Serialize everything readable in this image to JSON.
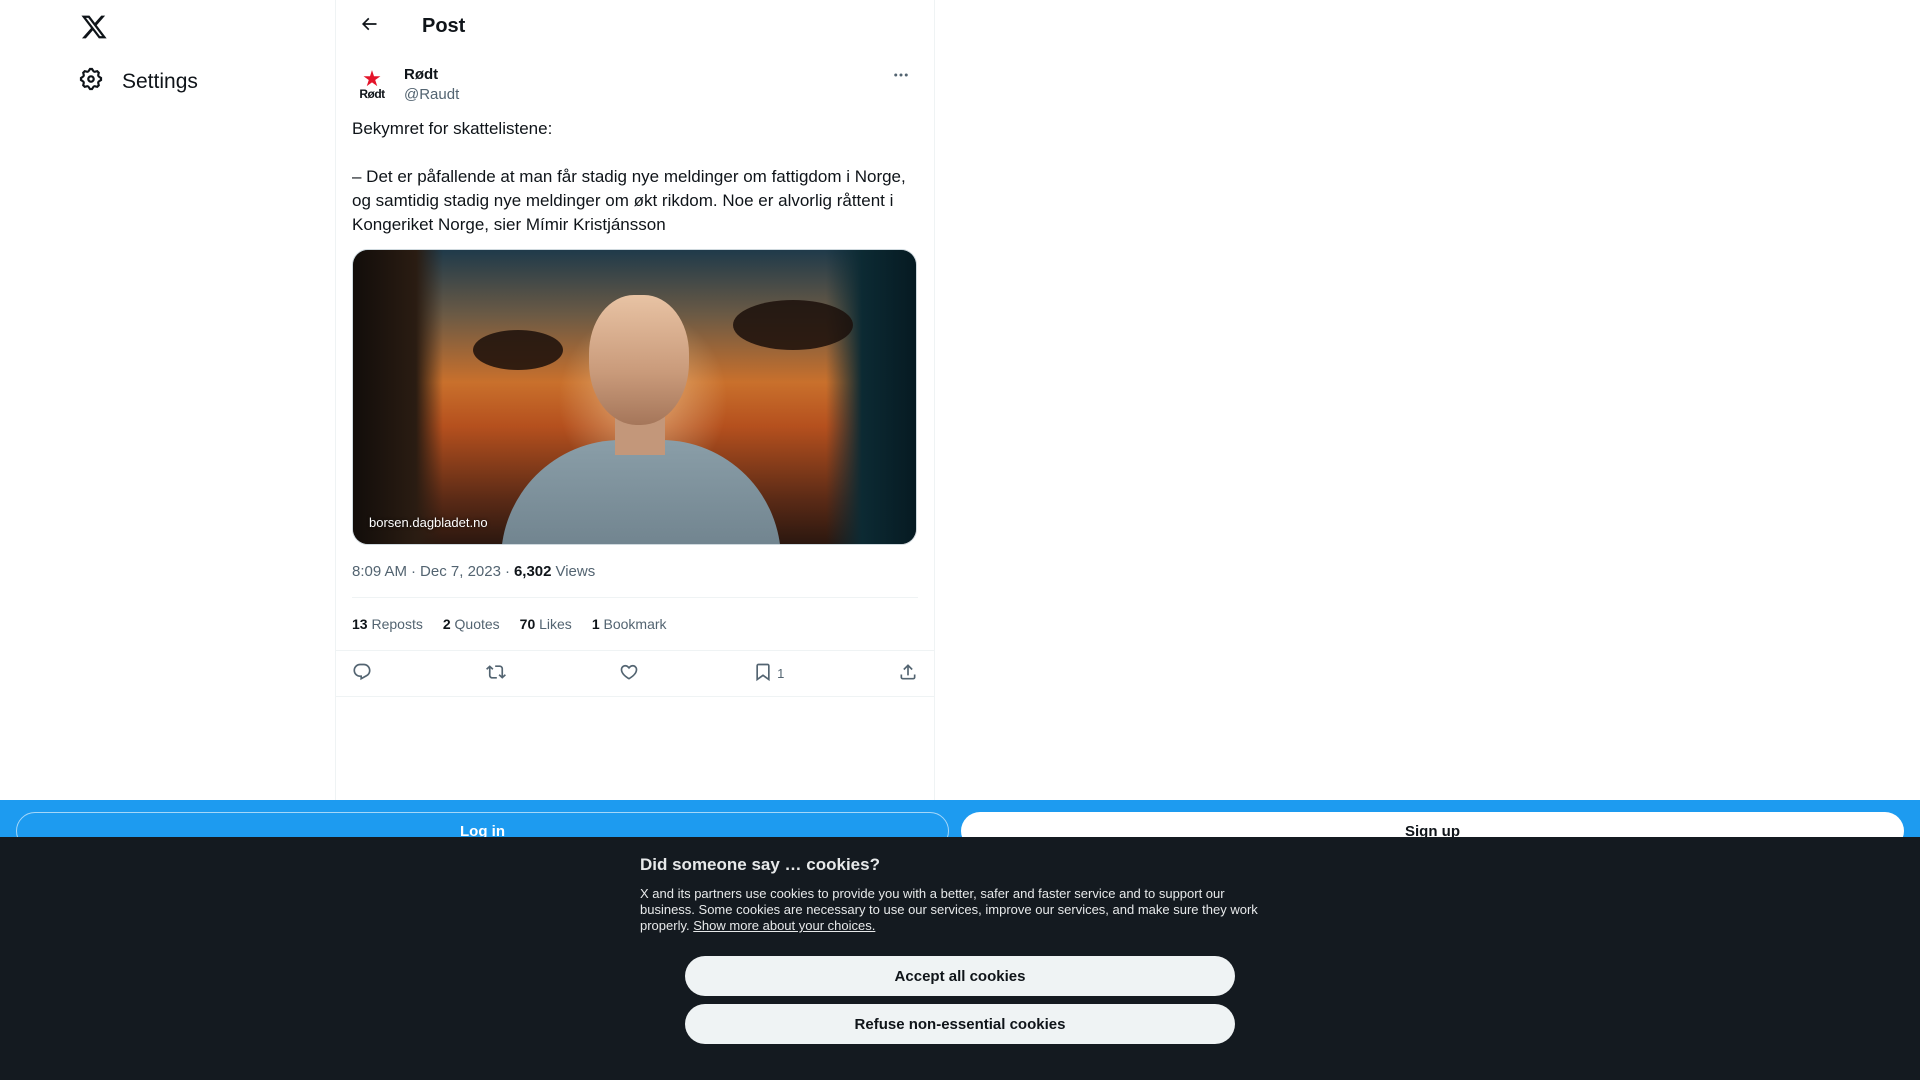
{
  "nav": {
    "logo_icon": "x-logo-icon",
    "settings_label": "Settings"
  },
  "header": {
    "title": "Post"
  },
  "tweet": {
    "display_name": "Rødt",
    "handle": "@Raudt",
    "avatar_wordmark": "Rødt",
    "text": "Bekymret for skattelistene:\n\n– Det er påfallende at man får stadig nye meldinger om fattigdom i Norge, og samtidig stadig nye meldinger om økt rikdom. Noe er alvorlig råttent i Kongeriket Norge, sier Mímir Kristjánsson",
    "media_source": "borsen.dagbladet.no",
    "time": "8:09 AM",
    "date": "Dec 7, 2023",
    "views_count": "6,302",
    "views_label": "Views",
    "stats": {
      "reposts_count": "13",
      "reposts_label": "Reposts",
      "quotes_count": "2",
      "quotes_label": "Quotes",
      "likes_count": "70",
      "likes_label": "Likes",
      "bookmarks_count": "1",
      "bookmarks_label": "Bookmark"
    },
    "actions": {
      "bookmark_count": "1"
    }
  },
  "loginbar": {
    "login_label": "Log in",
    "signup_label": "Sign up"
  },
  "cookie": {
    "title": "Did someone say … cookies?",
    "text": "X and its partners use cookies to provide you with a better, safer and faster service and to support our business. Some cookies are necessary to use our services, improve our services, and make sure they work properly.",
    "link": "Show more about your choices.",
    "accept_label": "Accept all cookies",
    "refuse_label": "Refuse non-essential cookies"
  },
  "colors": {
    "accent": "#1d9bf0",
    "brand_red": "#e4142a",
    "text_primary": "#0f1419",
    "text_secondary": "#536471",
    "cookie_bg": "#141a20"
  }
}
